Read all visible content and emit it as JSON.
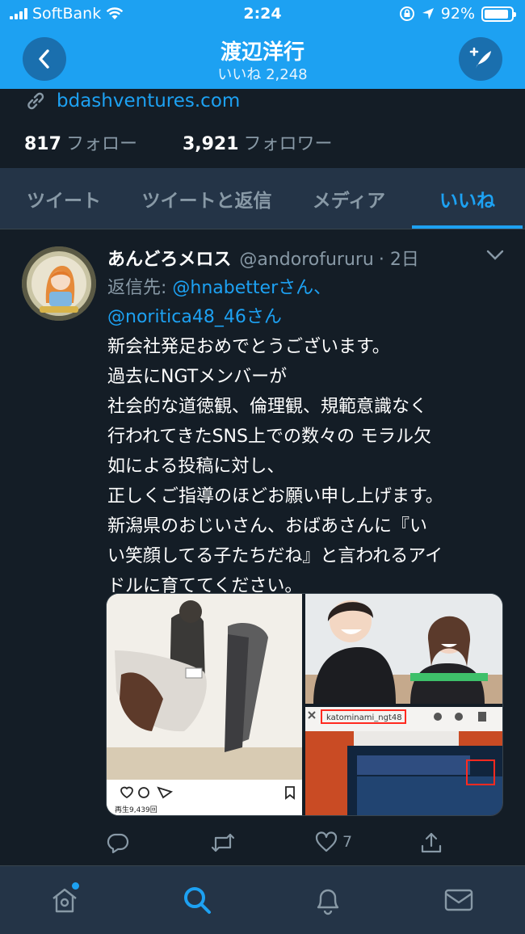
{
  "status_bar": {
    "carrier": "SoftBank",
    "time": "2:24",
    "battery": "92%",
    "battery_level": 0.92
  },
  "header": {
    "title": "渡辺洋行",
    "subtitle": "いいね 2,248"
  },
  "profile": {
    "website": "bdashventures.com",
    "following_count": "817",
    "following_label": "フォロー",
    "followers_count": "3,921",
    "followers_label": "フォロワー"
  },
  "tabs": [
    {
      "label": "ツイート",
      "active": false
    },
    {
      "label": "ツイートと返信",
      "active": false
    },
    {
      "label": "メディア",
      "active": false
    },
    {
      "label": "いいね",
      "active": true
    }
  ],
  "tweet": {
    "author_name": "あんどろメロス",
    "author_handle": "@andorofururu",
    "time": "· 2日",
    "replying_prefix": "返信先:",
    "replying_line1": "@hnabetterさん、",
    "replying_line2": "@noritica48_46さん",
    "body_lines": [
      "新会社発足おめでとうございます。",
      "過去にNGTメンバーが",
      "社会的な道徳観、倫理観、規範意識なく",
      "行われてきたSNS上での数々の モラル欠",
      "如による投稿に対し、",
      "正しくご指導のほどお願い申し上げます。",
      "新潟県のおじいさん、おばあさんに『い",
      "い笑顔してる子たちだね』と言われるアイ",
      "ドルに育ててください。"
    ],
    "media": {
      "caption_views": "再生9,439回",
      "overlay_username": "katominami_ngt48"
    },
    "actions": {
      "like_count": "7"
    }
  },
  "colors": {
    "accent": "#1da1f2",
    "background": "#141d26",
    "surface": "#243447",
    "muted": "#8899a6"
  }
}
